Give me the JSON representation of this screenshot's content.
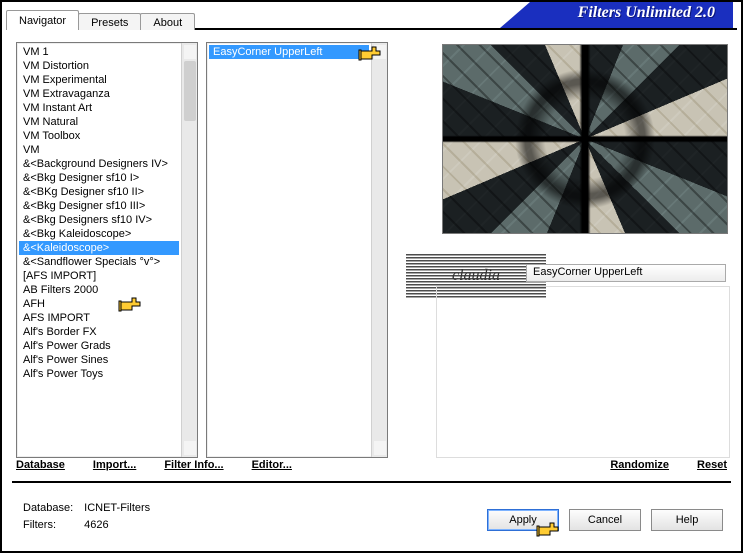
{
  "app": {
    "title": "Filters Unlimited 2.0"
  },
  "tabs": [
    {
      "label": "Navigator",
      "active": true
    },
    {
      "label": "Presets",
      "active": false
    },
    {
      "label": "About",
      "active": false
    }
  ],
  "categories": [
    "VM 1",
    "VM Distortion",
    "VM Experimental",
    "VM Extravaganza",
    "VM Instant Art",
    "VM Natural",
    "VM Toolbox",
    "VM",
    "&<Background Designers IV>",
    "&<Bkg Designer sf10 I>",
    "&<BKg Designer sf10 II>",
    "&<Bkg Designer sf10 III>",
    "&<Bkg Designers sf10 IV>",
    "&<Bkg Kaleidoscope>",
    "&<Kaleidoscope>",
    "&<Sandflower Specials °v°>",
    "[AFS IMPORT]",
    "AB Filters 2000",
    "AFH",
    "AFS IMPORT",
    "Alf's Border FX",
    "Alf's Power Grads",
    "Alf's Power Sines",
    "Alf's Power Toys"
  ],
  "category_selected_index": 14,
  "filters": [
    "EasyCorner UpperLeft"
  ],
  "filter_selected_index": 0,
  "selected_filter_name": "EasyCorner UpperLeft",
  "watermark": "claudia",
  "links": {
    "database": "Database",
    "import": "Import...",
    "filter_info": "Filter Info...",
    "editor": "Editor...",
    "randomize": "Randomize",
    "reset": "Reset"
  },
  "footer": {
    "db_label": "Database:",
    "db_value": "ICNET-Filters",
    "filters_label": "Filters:",
    "filters_value": "4626"
  },
  "buttons": {
    "apply": "Apply",
    "cancel": "Cancel",
    "help": "Help"
  }
}
